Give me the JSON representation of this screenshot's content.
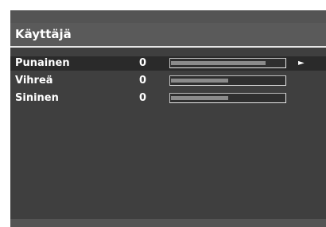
{
  "menu": {
    "title": "Käyttäjä",
    "arrow_glyph": "►",
    "items": [
      {
        "label": "Punainen",
        "value": "0",
        "fill_fraction": 0.83,
        "selected": true
      },
      {
        "label": "Vihreä",
        "value": "0",
        "fill_fraction": 0.5,
        "selected": false
      },
      {
        "label": "Sininen",
        "value": "0",
        "fill_fraction": 0.5,
        "selected": false
      }
    ]
  },
  "colors": {
    "background": "#3f3f3f",
    "title_bar": "#5a5a5a",
    "selected_row": "#2a2a2a",
    "text": "#ffffff",
    "slider_fill": "#8b8b8b"
  }
}
